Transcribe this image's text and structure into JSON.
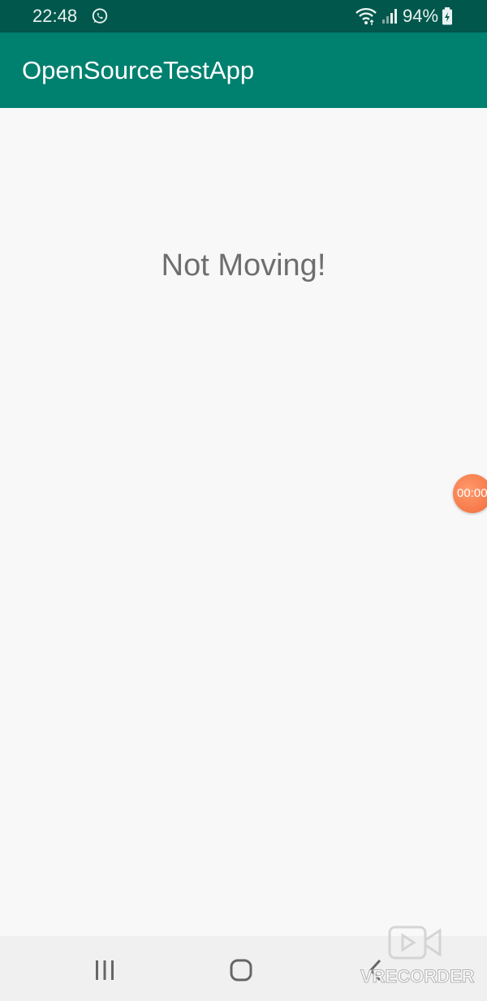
{
  "status_bar": {
    "time": "22:48",
    "battery": "94%",
    "icons": [
      "whatsapp-icon",
      "wifi-icon",
      "signal-icon",
      "battery-icon"
    ]
  },
  "app_bar": {
    "title": "OpenSourceTestApp"
  },
  "main": {
    "message": "Not Moving!"
  },
  "recorder": {
    "time": "00:00"
  },
  "navigation": {
    "items": [
      "recents-icon",
      "home-icon",
      "back-icon"
    ]
  },
  "watermark": {
    "text": "VRECORDER"
  },
  "colors": {
    "status_bar": "#02574c",
    "app_bar": "#00806f",
    "background": "#f8f8f9",
    "nav_bar": "#f0f0f1",
    "recorder_bubble": "#f26b3a"
  }
}
